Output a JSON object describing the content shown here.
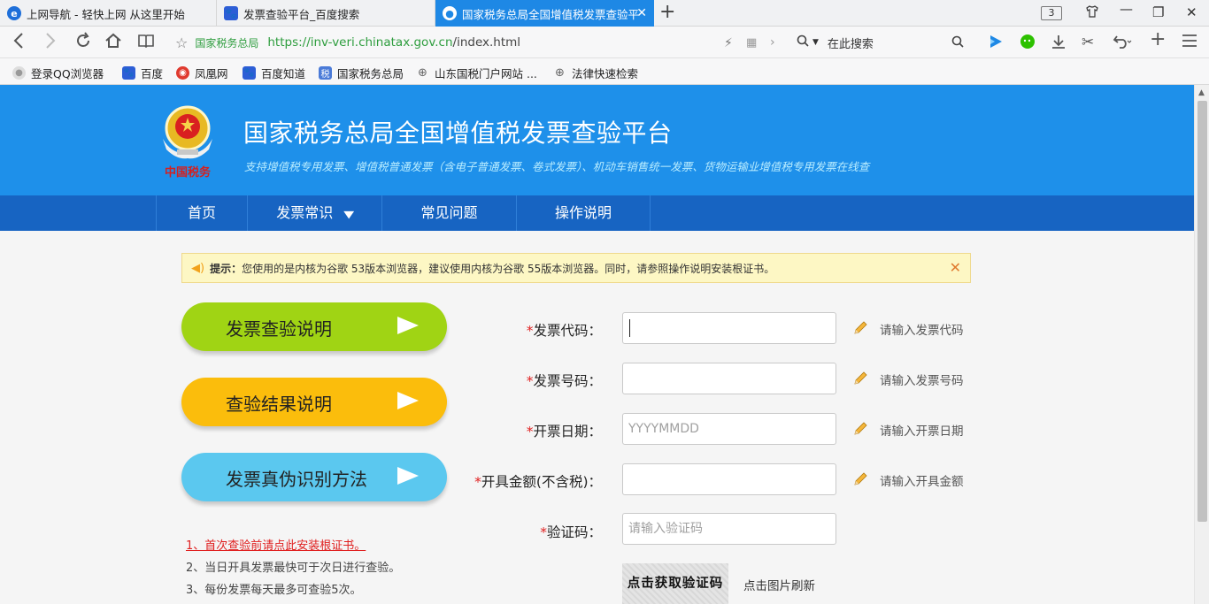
{
  "browser": {
    "tabs": [
      {
        "title": "上网导航 - 轻快上网 从这里开始"
      },
      {
        "title": "发票查验平台_百度搜索"
      },
      {
        "title": "国家税务总局全国增值税发票查验平台"
      }
    ],
    "tab_count": "3",
    "url_site_badge": "国家税务总局",
    "url_domain": "https://inv-veri.chinatax.gov.cn",
    "url_path": "/index.html",
    "search_placeholder": "在此搜索",
    "bookmarks": [
      {
        "label": "登录QQ浏览器",
        "icon": "user-icon"
      },
      {
        "label": "百度",
        "icon": "baidu-paw-icon"
      },
      {
        "label": "凤凰网",
        "icon": "phoenix-icon"
      },
      {
        "label": "百度知道",
        "icon": "baidu-paw-icon"
      },
      {
        "label": "国家税务总局",
        "icon": "tax-icon"
      },
      {
        "label": "山东国税门户网站 ...",
        "icon": "globe-icon"
      },
      {
        "label": "法律快速检索",
        "icon": "globe-icon"
      }
    ]
  },
  "header": {
    "title": "国家税务总局全国增值税发票查验平台",
    "subtitle": "支持增值税专用发票、增值税普通发票（含电子普通发票、卷式发票）、机动车销售统一发票、货物运输业增值税专用发票在线查",
    "emblem_text": "中国税务"
  },
  "menu": [
    {
      "label": "首页"
    },
    {
      "label": "发票常识"
    },
    {
      "label": "常见问题"
    },
    {
      "label": "操作说明"
    }
  ],
  "notice": {
    "prefix": "提示：",
    "text": "您使用的是内核为谷歌 53版本浏览器，建议使用内核为谷歌 55版本浏览器。同时，请参照操作说明安装根证书。"
  },
  "left_buttons": [
    {
      "label": "发票查验说明"
    },
    {
      "label": "查验结果说明"
    },
    {
      "label": "发票真伪识别方法"
    }
  ],
  "tips": [
    "1、首次查验前请点此安装根证书。",
    "2、当日开具发票最快可于次日进行查验。",
    "3、每份发票每天最多可查验5次。"
  ],
  "form": {
    "required_mark": "*",
    "fields": [
      {
        "label": "发票代码：",
        "value": "",
        "placeholder": "",
        "hint": "请输入发票代码"
      },
      {
        "label": "发票号码：",
        "value": "",
        "placeholder": "",
        "hint": "请输入发票号码"
      },
      {
        "label": "开票日期：",
        "value": "",
        "placeholder": "YYYYMMDD",
        "hint": "请输入开票日期"
      },
      {
        "label": "开具金额(不含税)：",
        "value": "",
        "placeholder": "",
        "hint": "请输入开具金额"
      },
      {
        "label": "验证码：",
        "value": "",
        "placeholder": "请输入验证码",
        "hint": ""
      }
    ],
    "captcha_text": "点击获取验证码",
    "captcha_refresh": "点击图片刷新"
  },
  "colors": {
    "header_bg": "#1e90ea",
    "menu_bg": "#1764c2",
    "green": "#a0d414",
    "orange": "#fbbd0c",
    "cyan": "#5bc8ef",
    "required": "#e02020"
  }
}
